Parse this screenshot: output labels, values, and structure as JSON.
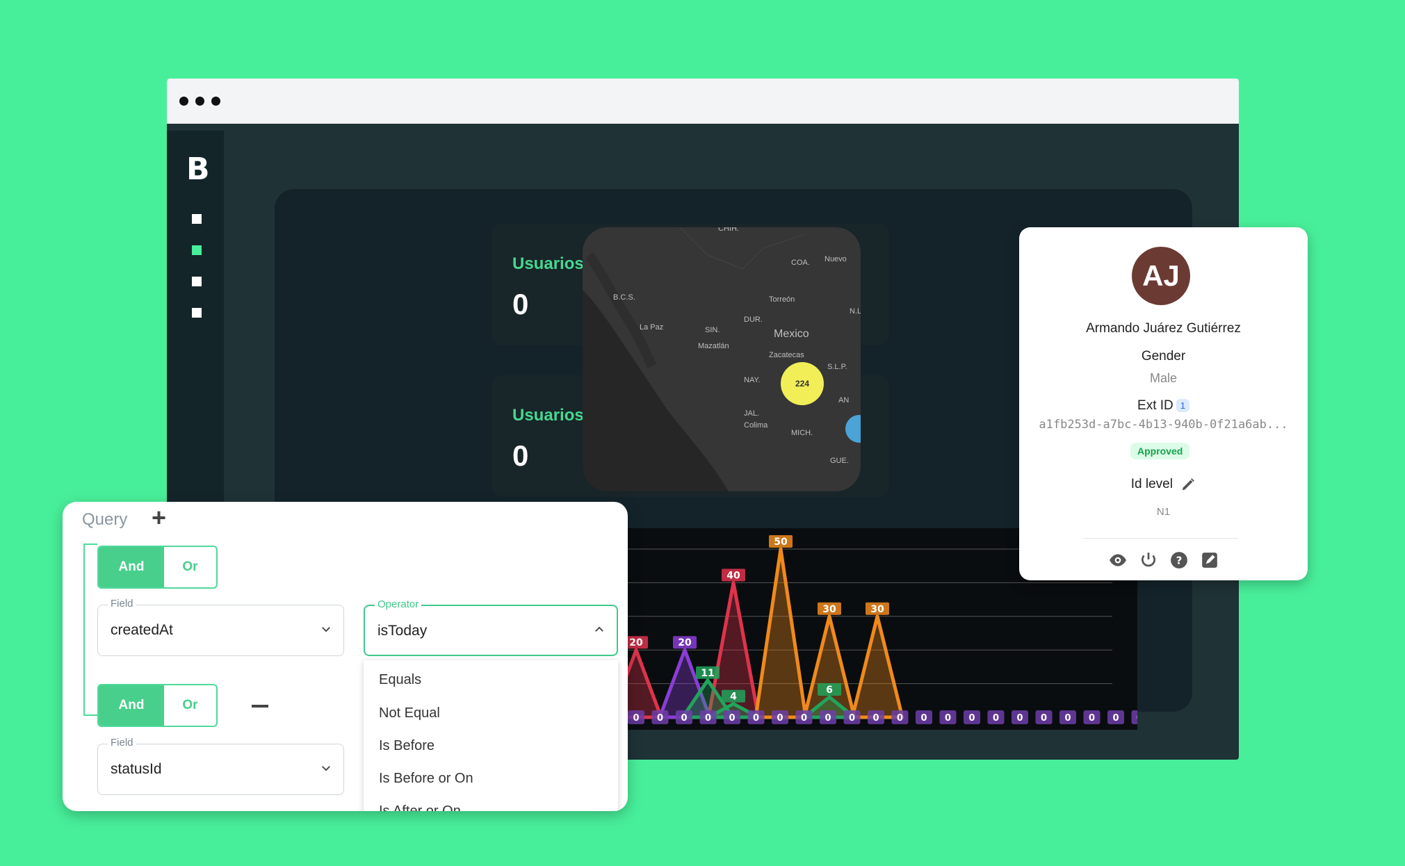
{
  "sidebar": {
    "logo": "B",
    "items": [
      "dashboard",
      "active",
      "item",
      "item"
    ]
  },
  "cards": [
    {
      "title": "Usuarios modificados hoy",
      "value": "0"
    },
    {
      "title": "Usuarios modificados hoy",
      "value": "0"
    }
  ],
  "map": {
    "labels": [
      "CHIH.",
      "COA.",
      "Nuevo",
      "B.C.S.",
      "Torreón",
      "N.L.",
      "La Paz",
      "DUR.",
      "SIN.",
      "Mexico",
      "Mazatlán",
      "Zacatecas",
      "S.L.P.",
      "NAY.",
      "JAL.",
      "Colima",
      "MICH.",
      "GUE.",
      "AN"
    ],
    "cluster_count": "224"
  },
  "chart_data": {
    "type": "area",
    "title": "",
    "series": [
      {
        "color": "#e0334c",
        "peaks": [
          {
            "label": "20",
            "value": 20
          },
          {
            "label": "40",
            "value": 40
          }
        ]
      },
      {
        "color": "#8a3dd6",
        "peaks": [
          {
            "label": "20",
            "value": 20
          }
        ]
      },
      {
        "color": "#f08a1c",
        "peaks": [
          {
            "label": "50",
            "value": 50
          },
          {
            "label": "30",
            "value": 30
          },
          {
            "label": "30",
            "value": 30
          },
          {
            "label": "0",
            "value": 0
          }
        ]
      },
      {
        "color": "#22a35c",
        "peaks": [
          {
            "label": "11",
            "value": 11
          },
          {
            "label": "4",
            "value": 4
          },
          {
            "label": "6",
            "value": 6
          },
          {
            "label": "0",
            "value": 0
          }
        ]
      }
    ],
    "zero_labels": [
      "0",
      "0",
      "0",
      "0",
      "0",
      "0",
      "0",
      "0",
      "0",
      "0",
      "0",
      "0",
      "0",
      "0",
      "0",
      "0",
      "0",
      "0",
      "0",
      "0",
      "0",
      "0",
      "0",
      "0",
      "0",
      "0",
      "0",
      "0",
      "0",
      "0"
    ]
  },
  "profile": {
    "initials": "AJ",
    "name": "Armando Juárez Gutiérrez",
    "gender_label": "Gender",
    "gender_value": "Male",
    "ext_id_label": "Ext ID",
    "ext_id_count": "1",
    "ext_id_value": "a1fb253d-a7bc-4b13-940b-0f21a6ab...",
    "status": "Approved",
    "id_level_label": "Id level",
    "id_level_value": "N1",
    "actions": [
      "eye-icon",
      "power-icon",
      "help-icon",
      "edit-square-icon"
    ]
  },
  "query": {
    "title": "Query",
    "groups": [
      {
        "and_label": "And",
        "or_label": "Or",
        "field_label": "Field",
        "field_value": "createdAt",
        "operator_label": "Operator",
        "operator_value": "isToday"
      },
      {
        "and_label": "And",
        "or_label": "Or",
        "field_label": "Field",
        "field_value": "statusId"
      }
    ],
    "operator_options": [
      "Equals",
      "Not Equal",
      "Is Before",
      "Is Before or On",
      "Is After or On"
    ]
  }
}
